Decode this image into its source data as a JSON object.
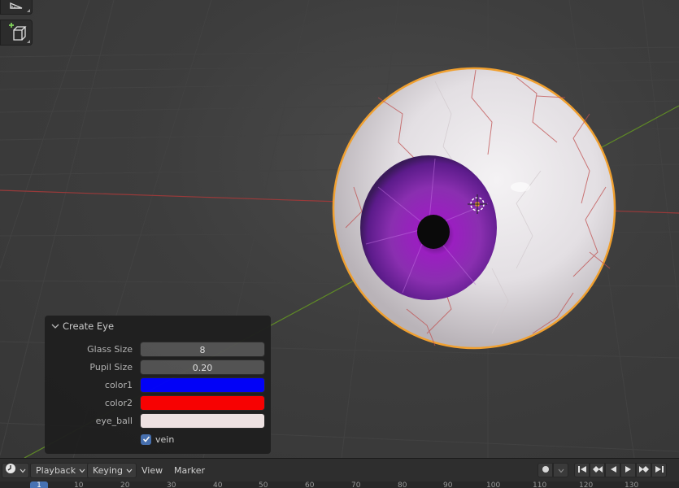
{
  "panel": {
    "title": "Create Eye",
    "properties": [
      {
        "label": "Glass Size",
        "value": "8"
      },
      {
        "label": "Pupil Size",
        "value": "0.20"
      },
      {
        "label": "color1",
        "color": "#0000ff"
      },
      {
        "label": "color2",
        "color": "#ff0000"
      },
      {
        "label": "eye_ball",
        "color": "#f5e8e8"
      }
    ],
    "vein": {
      "label": "vein",
      "checked": true
    }
  },
  "timeline": {
    "menus": [
      "Playback",
      "Keying"
    ],
    "items": [
      "View",
      "Marker"
    ],
    "current_frame": "1",
    "ticks": [
      "10",
      "20",
      "30",
      "40",
      "50",
      "60",
      "70",
      "80",
      "90",
      "100",
      "110",
      "120",
      "130"
    ]
  },
  "colors": {
    "viewport_bg": "#393939",
    "selection_outline": "#f0a030",
    "iris": "#8a2fb0",
    "x_axis": "#b04040",
    "y_axis": "#6a9a2a",
    "accent": "#4772b3"
  },
  "toolbar": {
    "icons": [
      "measure-tool-icon",
      "add-cube-tool-icon"
    ]
  }
}
